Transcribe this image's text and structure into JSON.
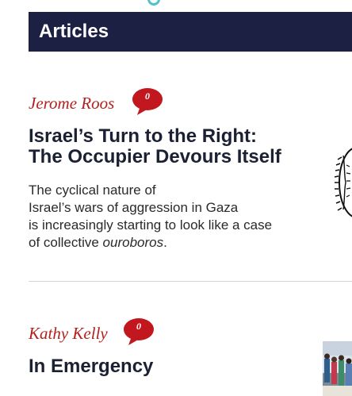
{
  "section": {
    "title": "Articles"
  },
  "articles": [
    {
      "author": "Jerome Roos",
      "comments": "0",
      "title_line1": "Israel’s Turn to the Right:",
      "title_line2": "The Occupier Devours Itself",
      "excerpt_line1": "The cyclical nature of",
      "excerpt_line2": "Israel’s wars of aggression in Gaza",
      "excerpt_line3": "is increasingly starting to look like a case",
      "excerpt_line4_start": "of collective ",
      "excerpt_line4_em": "ouroboros",
      "excerpt_line4_end": "."
    },
    {
      "author": "Kathy Kelly",
      "comments": "0",
      "title": "In Emergency"
    }
  ],
  "colors": {
    "header_bg": "#1c2143",
    "author": "#b3211f",
    "bubble": "#c2171e",
    "headline": "#1c2033"
  },
  "icons": {
    "top_ornament": "ring-icon",
    "comments": "speech-bubble-icon"
  }
}
